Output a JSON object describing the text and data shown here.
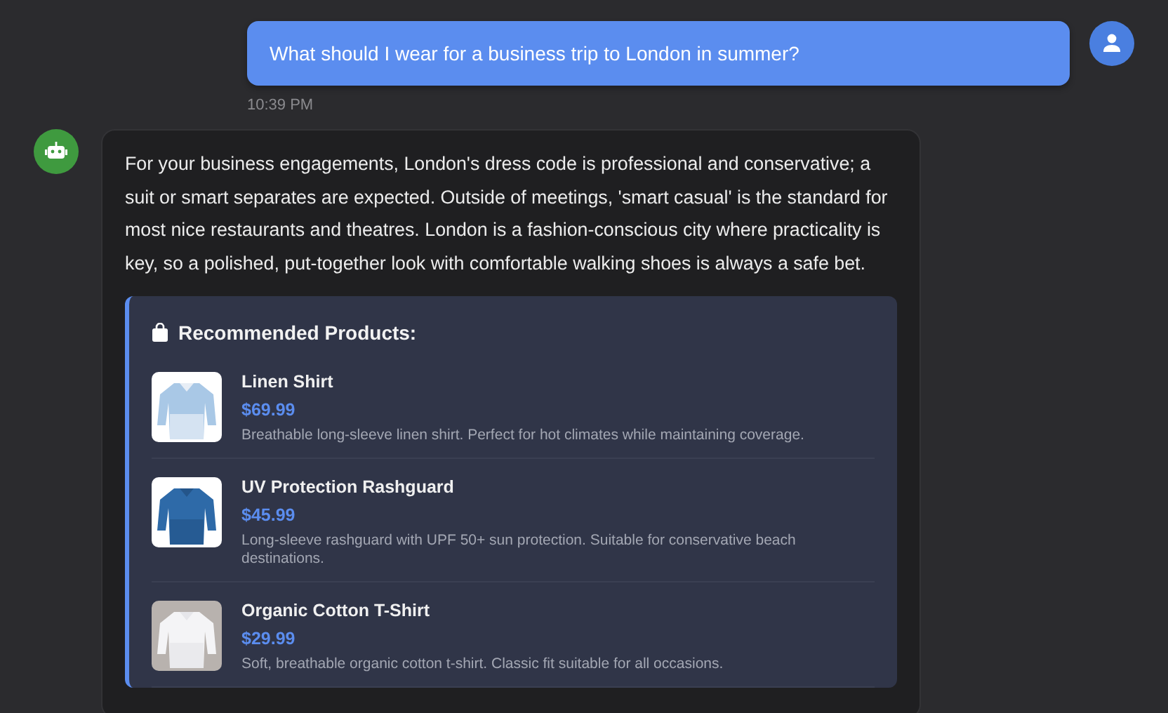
{
  "user_message": {
    "text": "What should I wear for a business trip to London in summer?",
    "time": "10:39 PM"
  },
  "bot_message": {
    "text": "For your business engagements, London's dress code is professional and conservative; a suit or smart separates are expected. Outside of meetings, 'smart casual' is the standard for most nice restaurants and theatres. London is a fashion-conscious city where practicality is key, so a polished, put-together look with comfortable walking shoes is always a safe bet.",
    "products": {
      "title": "Recommended Products:",
      "items": [
        {
          "name": "Linen Shirt",
          "price": "$69.99",
          "description": "Breathable long-sleeve linen shirt. Perfect for hot climates while maintaining coverage."
        },
        {
          "name": "UV Protection Rashguard",
          "price": "$45.99",
          "description": "Long-sleeve rashguard with UPF 50+ sun protection. Suitable for conservative beach destinations."
        },
        {
          "name": "Organic Cotton T-Shirt",
          "price": "$29.99",
          "description": "Soft, breathable organic cotton t-shirt. Classic fit suitable for all occasions."
        }
      ]
    }
  }
}
